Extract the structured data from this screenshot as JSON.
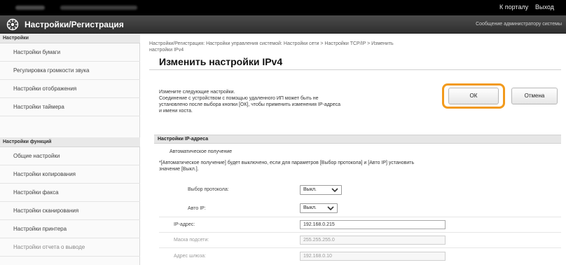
{
  "topbar": {
    "portal_link": "К порталу",
    "logout_link": "Выход"
  },
  "header": {
    "title": "Настройки/Регистрация",
    "admin_message": "Сообщение администратору системы"
  },
  "sidebar": {
    "section1": "Настройки",
    "items1": [
      "Настройки бумаги",
      "Регулировка громкости звука",
      "Настройки отображения",
      "Настройки таймера"
    ],
    "section2": "Настройки функций",
    "items2": [
      "Общие настройки",
      "Настройки копирования",
      "Настройки факса",
      "Настройки сканирования",
      "Настройки принтера",
      "Настройки отчета о выводе"
    ]
  },
  "breadcrumb": {
    "line1": "Настройки/Регистрация: Настройки управления системой: Настройки сети > Настройки TCP/IP > Изменить",
    "line2": "настройки IPv4"
  },
  "page_title": "Изменить настройки IPv4",
  "description": {
    "line1": "Измените следующие настройки.",
    "line2": "Соединение с устройством с помощью удаленного ИП может быть не",
    "line3": "установлено после выбора кнопки [ОК], чтобы применить изменения IP-адреса",
    "line4": "и имени хоста."
  },
  "buttons": {
    "ok": "ОК",
    "cancel": "Отмена"
  },
  "ip_section": {
    "heading": "Настройки IP-адреса",
    "auto_label": "Автоматическое получение",
    "note_line1": "*[Автоматическое получение] будет выключено, если для параметров [Выбор протокола] и [Авто IP] установить",
    "note_line2": "значение [Выкл.].",
    "protocol_label": "Выбор протокола:",
    "protocol_value": "Выкл.",
    "auto_ip_label": "Авто IP:",
    "auto_ip_value": "Выкл.",
    "ip_label": "IP-адрес:",
    "ip_value": "192.168.0.215",
    "mask_label": "Маска подсети:",
    "mask_value": "255.255.255.0",
    "gateway_label": "Адрес шлюза:",
    "gateway_value": "192.168.0.10"
  }
}
